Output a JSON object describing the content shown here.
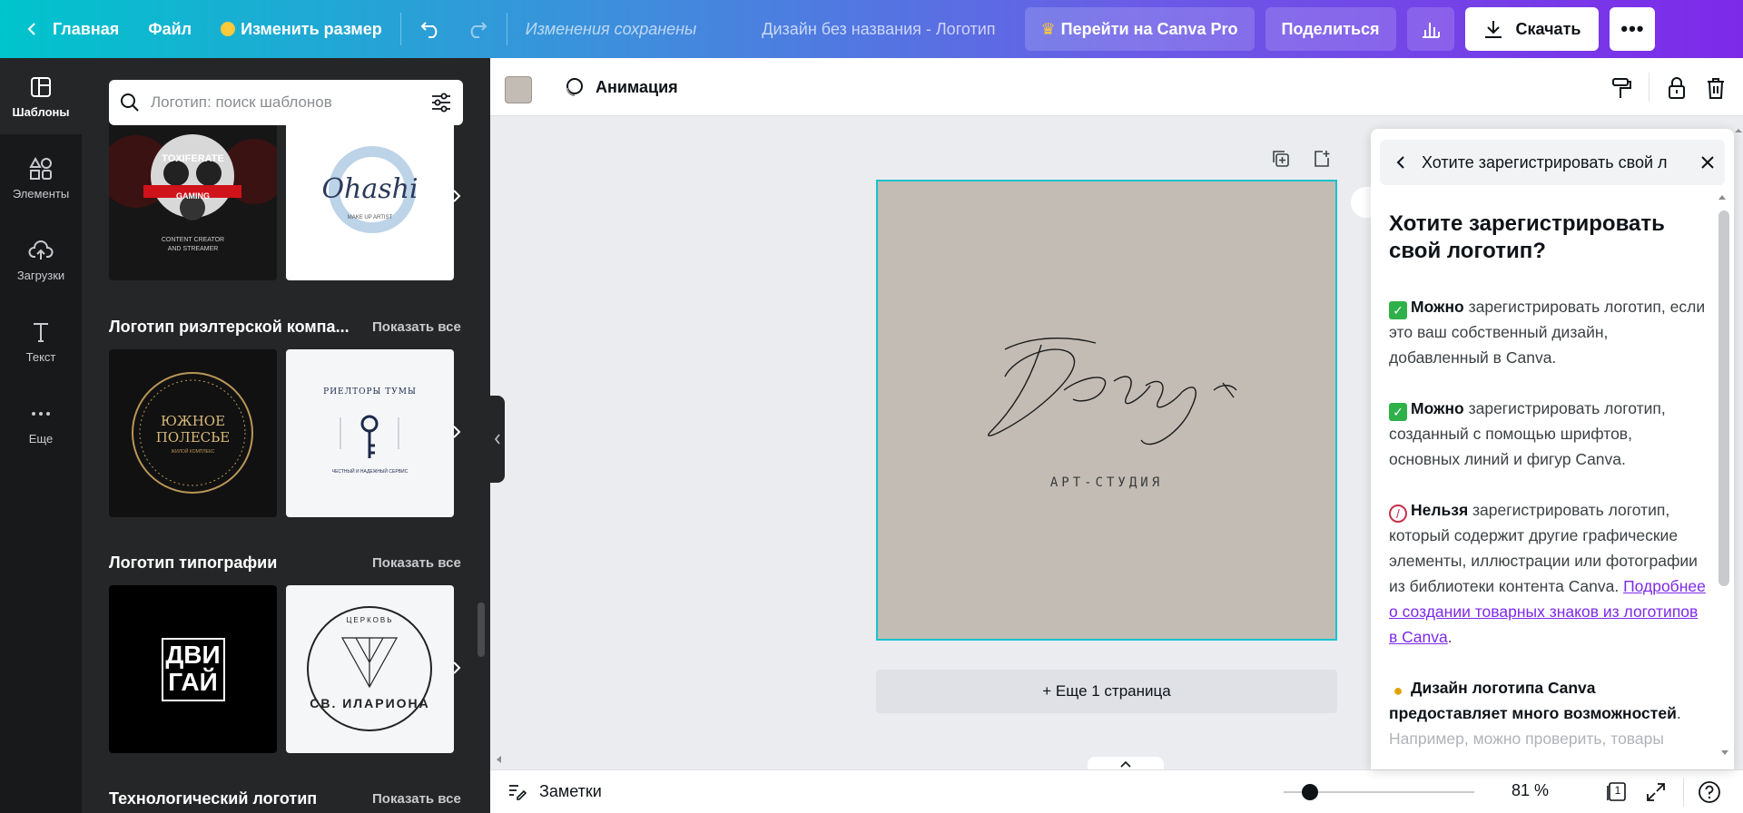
{
  "topbar": {
    "home_label": "Главная",
    "file_label": "Файл",
    "resize_label": "Изменить размер",
    "save_status": "Изменения сохранены",
    "doc_title": "Дизайн без названия - Логотип",
    "pro_label": "Перейти на Canva Pro",
    "share_label": "Поделиться",
    "download_label": "Скачать"
  },
  "rail": {
    "items": [
      {
        "label": "Шаблоны",
        "icon": "templates-icon"
      },
      {
        "label": "Элементы",
        "icon": "elements-icon"
      },
      {
        "label": "Загрузки",
        "icon": "uploads-icon"
      },
      {
        "label": "Текст",
        "icon": "text-icon"
      },
      {
        "label": "Еще",
        "icon": "more-icon"
      }
    ]
  },
  "panel": {
    "search_placeholder": "Логотип: поиск шаблонов",
    "sections": [
      {
        "title": "Логотип риэлтерской компа...",
        "link": "Показать все"
      },
      {
        "title": "Логотип типографии",
        "link": "Показать все"
      },
      {
        "title": "Технологический логотип",
        "link": "Показать все"
      }
    ],
    "thumbs": {
      "toxiferate": {
        "line1": "TOXIFERATE",
        "line2": "GAMING",
        "line3": "CONTENT CREATOR",
        "line4": "AND STREAMER"
      },
      "ohashi": {
        "name": "Ohashi",
        "sub": "MAKE UP ARTIST"
      },
      "polesye": {
        "line1": "ЮЖНОЕ",
        "line2": "ПОЛЕСЬЕ",
        "sub": "ЖИЛОЙ КОМПЛЕКС"
      },
      "tumy": {
        "top": "РИЕЛТОРЫ ТУМЫ",
        "bottom": "ЧЕСТНЫЙ И НАДЕЖНЫЙ СЕРВИС"
      },
      "dvigai": {
        "line1": "ДВИ",
        "line2": "ГАЙ"
      },
      "church": {
        "top": "ЦЕРКОВЬ",
        "bottom": "СВ. ИЛАРИОНА"
      }
    }
  },
  "toolbar": {
    "animation_label": "Анимация",
    "swatch_color": "#c2bcb5"
  },
  "canvas": {
    "logo_script": "Воздух",
    "logo_sub": "АРТ-СТУДИЯ",
    "add_page_label": "+ Еще 1 страница",
    "background_color": "#c2bcb5"
  },
  "bottombar": {
    "notes_label": "Заметки",
    "zoom_label": "81 %",
    "page_count": "1"
  },
  "help": {
    "header": "Хотите зарегистрировать свой л",
    "title": "Хотите зарегистрировать свой логотип?",
    "p1_bold": "Можно",
    "p1_text": " зарегистрировать логотип, если это ваш собственный дизайн, добавленный в Canva.",
    "p2_bold": "Можно",
    "p2_text": " зарегистрировать логотип, созданный с помощью шрифтов, основных линий и фигур Canva.",
    "p3_bold": "Нельзя",
    "p3_text": " зарегистрировать логотип, который содержит другие графические элементы, иллюстрации или фотографии из библиотеки контента Canva. ",
    "p3_link": "Подробнее о создании товарных знаков из логотипов в Canva",
    "p3_end": ".",
    "p4_bold": "Дизайн логотипа Canva предоставляет много возможностей",
    "p4_end": ".",
    "p4_cut": "Например, можно проверить, товары"
  },
  "colors": {
    "accent": "#7d2ae8",
    "selection": "#18c3cc",
    "check": "#2fb14a",
    "forbidden": "#c8304a"
  }
}
